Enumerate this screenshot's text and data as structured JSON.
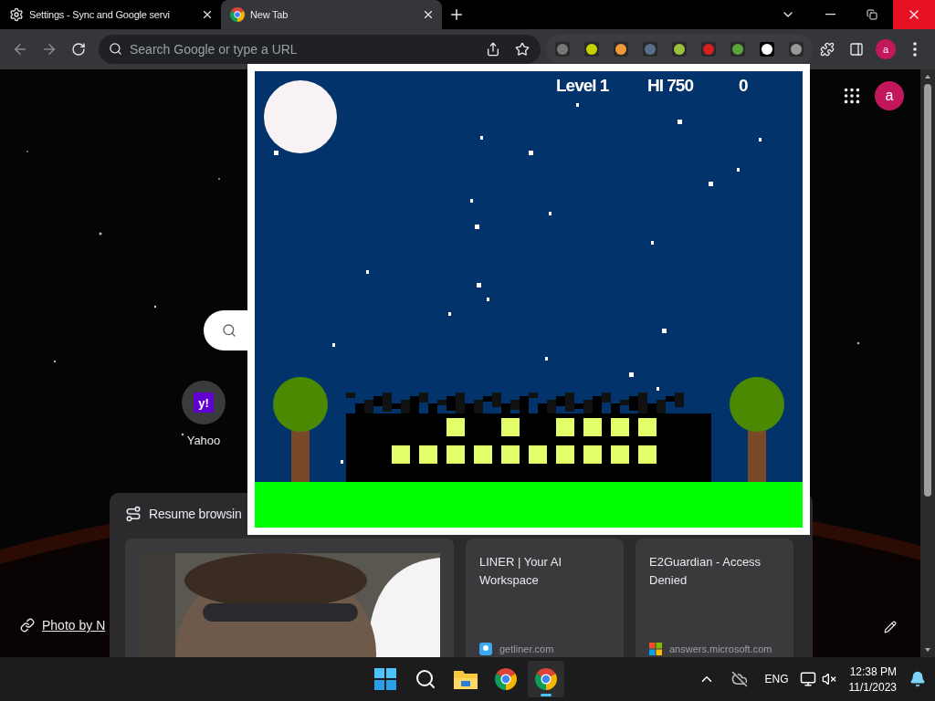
{
  "tabs": [
    {
      "title": "Settings - Sync and Google servi",
      "selected": false
    },
    {
      "title": "New Tab",
      "selected": true
    }
  ],
  "omnibox": {
    "placeholder": "Search Google or type a URL"
  },
  "toolbar_avatar": "a",
  "new_tab_page": {
    "avatar": "a",
    "shortcuts": [
      {
        "label": "Yahoo",
        "logo_text": "y!"
      }
    ],
    "resume": {
      "heading": "Resume browsin",
      "cards": [
        {
          "kind": "picture"
        },
        {
          "kind": "page",
          "title": "LINER | Your AI Workspace",
          "domain": "getliner.com"
        },
        {
          "kind": "page",
          "title": "E2Guardian - Access Denied",
          "domain": "answers.microsoft.com"
        }
      ]
    },
    "photo_credit": "Photo by N"
  },
  "game": {
    "level": "Level 1",
    "hi_score": "HI 750",
    "score": "0"
  },
  "taskbar": {
    "apps": [
      {
        "kind": "start",
        "selected": false
      },
      {
        "kind": "search",
        "selected": false
      },
      {
        "kind": "explorer",
        "selected": false
      },
      {
        "kind": "chrome",
        "selected": false
      },
      {
        "kind": "chrome",
        "selected": true
      }
    ],
    "language": "ENG",
    "time": "12:38 PM",
    "date": "11/1/2023"
  }
}
